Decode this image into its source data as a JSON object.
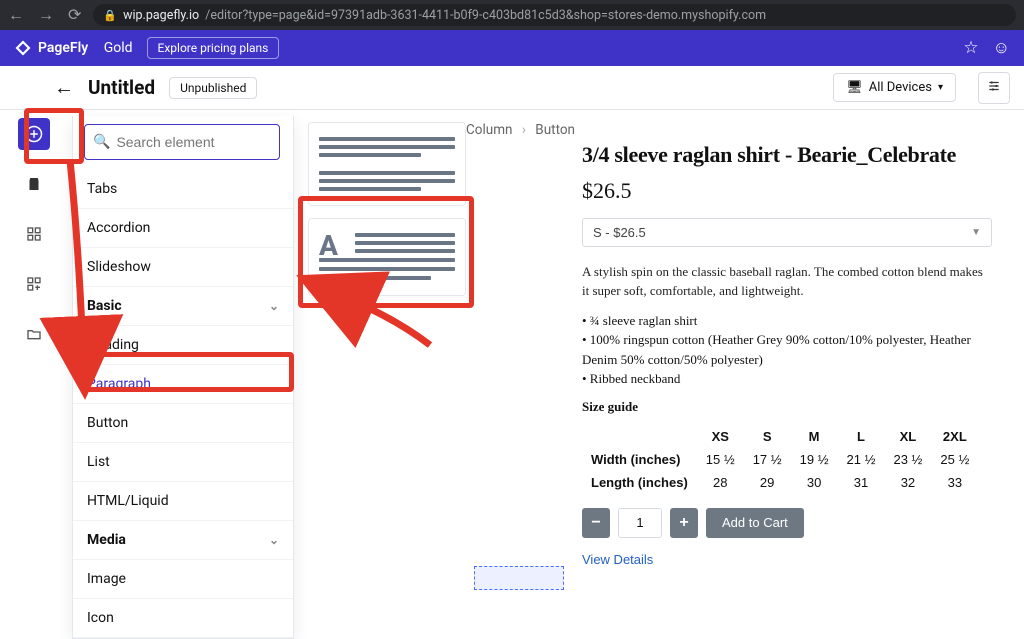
{
  "browser": {
    "domain": "wip.pagefly.io",
    "path": "/editor?type=page&id=97391adb-3631-4411-b0f9-c403bd81c5d3&shop=stores-demo.myshopify.com"
  },
  "app_bar": {
    "brand": "PageFly",
    "brand_suffix": "Gold",
    "pricing": "Explore pricing plans"
  },
  "header": {
    "title": "Untitled",
    "status": "Unpublished",
    "devices": "All Devices"
  },
  "search": {
    "placeholder": "Search element"
  },
  "panel": {
    "items_top": [
      "Tabs",
      "Accordion",
      "Slideshow"
    ],
    "cat_basic": "Basic",
    "basic_items": [
      "Heading",
      "Paragraph",
      "Button",
      "List",
      "HTML/Liquid"
    ],
    "cat_media": "Media",
    "media_items": [
      "Image",
      "Icon"
    ]
  },
  "breadcrumb": {
    "a": "Column",
    "b": "Button"
  },
  "product": {
    "title": "3/4 sleeve raglan shirt - Bearie_Celebrate",
    "price": "$26.5",
    "variant": "S - $26.5",
    "desc": "A stylish spin on the classic baseball raglan. The combed cotton blend makes it super soft, comfortable, and lightweight.",
    "bullet1": "• ¾ sleeve raglan shirt",
    "bullet2": "• 100% ringspun cotton (Heather Grey 90% cotton/10% polyester, Heather Denim 50% cotton/50% polyester)",
    "bullet3": "• Ribbed neckband",
    "sizeguide": "Size guide",
    "qty": "1",
    "addcart": "Add to Cart",
    "viewdetails": "View Details"
  },
  "chart_data": {
    "type": "table",
    "title": "Size guide",
    "columns": [
      "",
      "XS",
      "S",
      "M",
      "L",
      "XL",
      "2XL"
    ],
    "rows": [
      {
        "label": "Width (inches)",
        "values": [
          "15 ½",
          "17 ½",
          "19 ½",
          "21 ½",
          "23 ½",
          "25 ½"
        ]
      },
      {
        "label": "Length (inches)",
        "values": [
          "28",
          "29",
          "30",
          "31",
          "32",
          "33"
        ]
      }
    ]
  }
}
